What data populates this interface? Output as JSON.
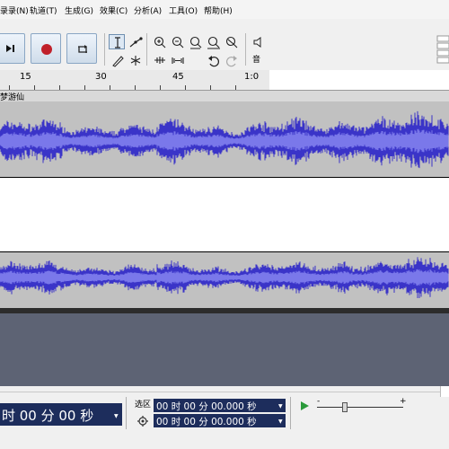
{
  "menu": [
    "录录(N)",
    "轨道(T)",
    "生成(G)",
    "效果(C)",
    "分析(A)",
    "工具(O)",
    "帮助(H)"
  ],
  "toolbar": {
    "meter_label": "音"
  },
  "ruler": {
    "labels": [
      "15",
      "30",
      "45",
      "1:0"
    ]
  },
  "track": {
    "name": "梦游仙"
  },
  "time": {
    "audio_position": "时 00 分 00 秒",
    "selection_label": "选区",
    "selection_start": "00 时 00 分 00.000 秒",
    "selection_end": "00 时 00 分 00.000 秒"
  },
  "colors": {
    "waveform": "#3a34c8",
    "waveform_rms": "#7a78ea",
    "track_bg": "#c1c1c1",
    "time_display_bg": "#1d2d5c",
    "empty_area": "#5d6374"
  }
}
